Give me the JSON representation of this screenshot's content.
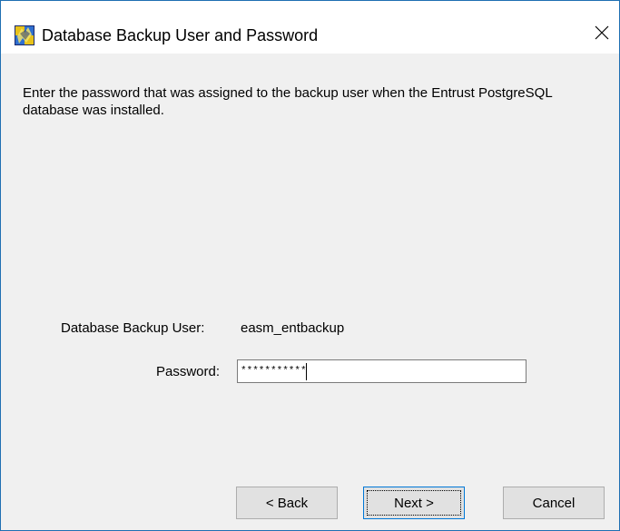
{
  "window": {
    "title": "Database Backup User and Password",
    "icon": "app-icon",
    "close_icon": "close-icon"
  },
  "main": {
    "description": "Enter the password that was assigned to the backup user when the Entrust PostgreSQL database was installed.",
    "backup_user_label": "Database Backup User:",
    "backup_user_value": "easm_entbackup",
    "password_label": "Password:",
    "password_value": "***********"
  },
  "buttons": {
    "back": "< Back",
    "next": "Next >",
    "cancel": "Cancel"
  },
  "colors": {
    "window_border": "#1f6fb2",
    "button_focus_border": "#0078d7",
    "background": "#f0f0f0"
  }
}
